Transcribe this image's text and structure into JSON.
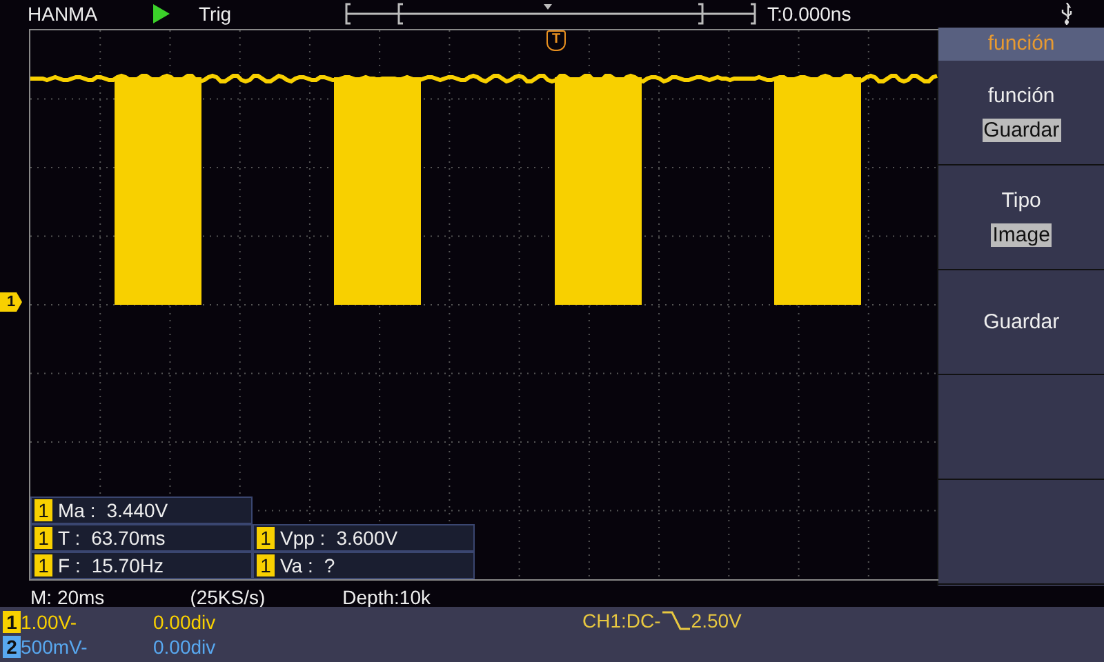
{
  "top_bar": {
    "brand": "HANMA",
    "running": true,
    "run_state": "Trig",
    "trigger_time": "T:0.000ns"
  },
  "trigger_marker": "T",
  "channel_marker": "1",
  "measurements": [
    [
      {
        "channel": "1",
        "label": "Ma :",
        "value": "3.440V"
      }
    ],
    [
      {
        "channel": "1",
        "label": "T :",
        "value": "63.70ms"
      },
      {
        "channel": "1",
        "label": "Vpp :",
        "value": "3.600V"
      }
    ],
    [
      {
        "channel": "1",
        "label": "F :",
        "value": "15.70Hz"
      },
      {
        "channel": "1",
        "label": "Va :",
        "value": "?"
      }
    ]
  ],
  "timebase": {
    "scale": "M: 20ms",
    "rate": "(25KS/s)",
    "depth": "Depth:10k"
  },
  "channels": [
    {
      "number": "1",
      "scale": "1.00V-",
      "offset": "0.00div",
      "color": "#f8d000"
    },
    {
      "number": "2",
      "scale": "500mV-",
      "offset": "0.00div",
      "color": "#58a8f0"
    }
  ],
  "trigger": {
    "source": "CH1:DC-",
    "level": "2.50V"
  },
  "menu": {
    "title": "función",
    "items": [
      {
        "label": "función",
        "value": "Guardar"
      },
      {
        "label": "Tipo",
        "value": "Image"
      },
      {
        "label": "Guardar"
      }
    ]
  }
}
